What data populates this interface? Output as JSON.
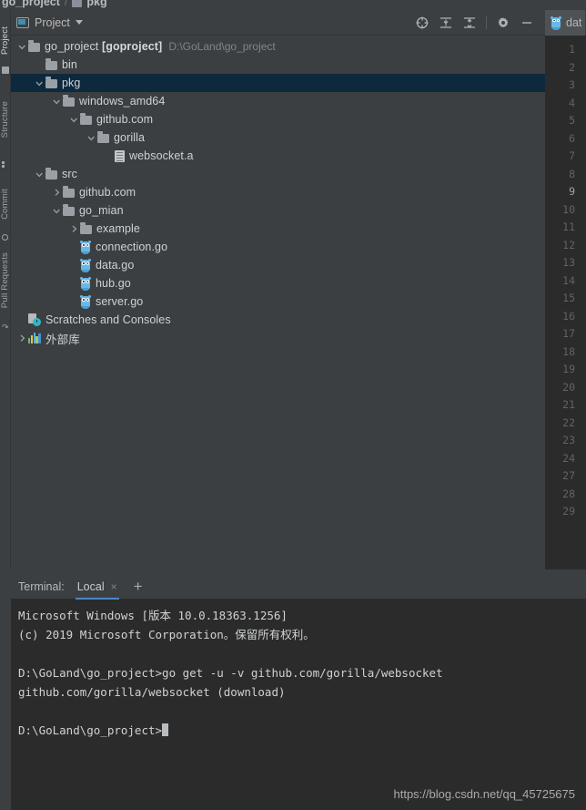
{
  "breadcrumb": {
    "project": "go_project",
    "separator": "/",
    "current": "pkg"
  },
  "toolwindows": [
    {
      "label": "Project",
      "icon": "project-icon",
      "active": true
    },
    {
      "label": "Structure",
      "icon": "structure-icon",
      "active": false
    },
    {
      "label": "Commit",
      "icon": "commit-icon",
      "active": false
    },
    {
      "label": "Pull Requests",
      "icon": "pull-requests-icon",
      "active": false
    }
  ],
  "project_panel": {
    "title": "Project",
    "actions": [
      {
        "name": "select-opened-file-button",
        "icon": "crosshair-target-icon"
      },
      {
        "name": "expand-all-button",
        "icon": "expand-all-icon"
      },
      {
        "name": "collapse-all-button",
        "icon": "collapse-all-icon"
      },
      {
        "name": "settings-button",
        "icon": "gear-icon"
      },
      {
        "name": "hide-button",
        "icon": "minimize-icon"
      }
    ],
    "tree": [
      {
        "indent": 0,
        "arrow": "down",
        "icon": "folder",
        "label": "go_project",
        "bold_label": "[goproject]",
        "path": "D:\\GoLand\\go_project",
        "selected": false
      },
      {
        "indent": 1,
        "arrow": "none",
        "icon": "folder",
        "label": "bin",
        "selected": false
      },
      {
        "indent": 1,
        "arrow": "down",
        "icon": "folder",
        "label": "pkg",
        "selected": true
      },
      {
        "indent": 2,
        "arrow": "down",
        "icon": "folder",
        "label": "windows_amd64",
        "selected": false
      },
      {
        "indent": 3,
        "arrow": "down",
        "icon": "folder",
        "label": "github.com",
        "selected": false
      },
      {
        "indent": 4,
        "arrow": "down",
        "icon": "folder",
        "label": "gorilla",
        "selected": false
      },
      {
        "indent": 5,
        "arrow": "none",
        "icon": "archive",
        "label": "websocket.a",
        "selected": false
      },
      {
        "indent": 1,
        "arrow": "down",
        "icon": "folder",
        "label": "src",
        "selected": false
      },
      {
        "indent": 2,
        "arrow": "right",
        "icon": "folder",
        "label": "github.com",
        "selected": false
      },
      {
        "indent": 2,
        "arrow": "down",
        "icon": "folder",
        "label": "go_mian",
        "selected": false
      },
      {
        "indent": 3,
        "arrow": "right",
        "icon": "folder",
        "label": "example",
        "selected": false
      },
      {
        "indent": 3,
        "arrow": "none",
        "icon": "gopher",
        "label": "connection.go",
        "selected": false
      },
      {
        "indent": 3,
        "arrow": "none",
        "icon": "gopher",
        "label": "data.go",
        "selected": false
      },
      {
        "indent": 3,
        "arrow": "none",
        "icon": "gopher",
        "label": "hub.go",
        "selected": false
      },
      {
        "indent": 3,
        "arrow": "none",
        "icon": "gopher",
        "label": "server.go",
        "selected": false
      },
      {
        "indent": 0,
        "arrow": "none",
        "icon": "scratch",
        "label": "Scratches and Consoles",
        "selected": false
      },
      {
        "indent": 0,
        "arrow": "right",
        "icon": "extlib",
        "label": "外部库",
        "selected": false
      }
    ]
  },
  "editor": {
    "tab": {
      "label": "dat",
      "icon": "go-file-icon"
    },
    "line_numbers": [
      "1",
      "2",
      "3",
      "4",
      "5",
      "6",
      "7",
      "8",
      "9",
      "10",
      "11",
      "12",
      "13",
      "14",
      "15",
      "16",
      "17",
      "18",
      "19",
      "20",
      "21",
      "22",
      "23",
      "24",
      "27",
      "28",
      "29"
    ],
    "current_line": "9"
  },
  "terminal": {
    "label": "Terminal:",
    "tab": "Local",
    "close_glyph": "×",
    "add_glyph": "+",
    "lines": [
      "Microsoft Windows [版本 10.0.18363.1256]",
      "(c) 2019 Microsoft Corporation。保留所有权利。",
      "",
      "D:\\GoLand\\go_project>go get -u -v github.com/gorilla/websocket",
      "github.com/gorilla/websocket (download)",
      "",
      "D:\\GoLand\\go_project>"
    ],
    "prompt_last": "D:\\GoLand\\go_project>"
  },
  "watermark": "https://blog.csdn.net/qq_45725675",
  "colors": {
    "panel_bg": "#3c3f41",
    "editor_bg": "#2b2b2b",
    "selection_bg": "#0d293e",
    "accent": "#4a88c7",
    "text": "#bdc1c4",
    "muted": "#808589",
    "go_icon": "#67b9e8"
  }
}
